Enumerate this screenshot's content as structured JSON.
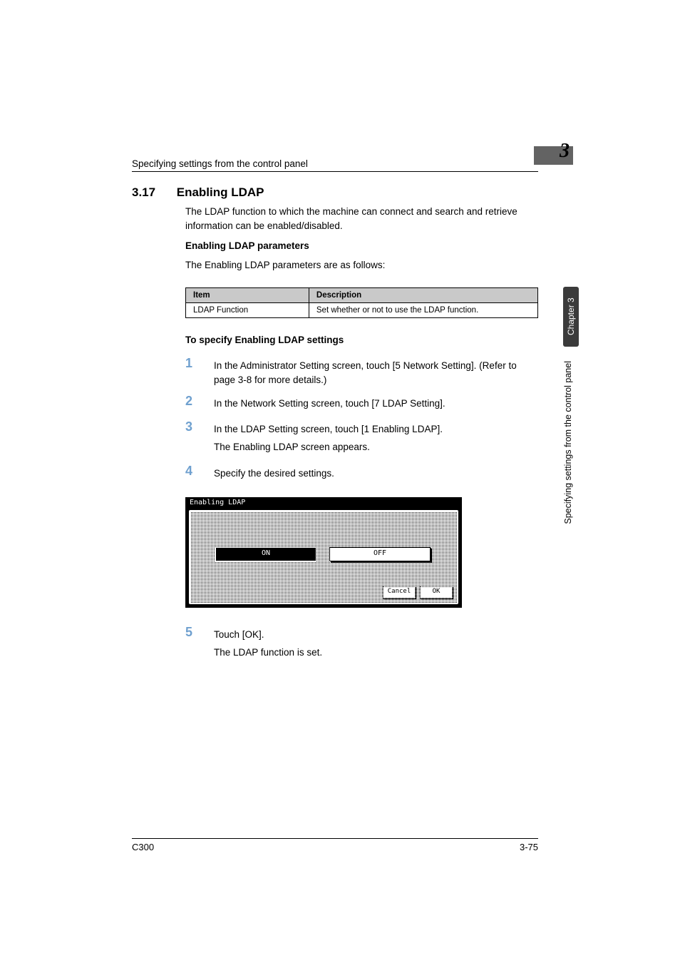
{
  "header": {
    "running_title": "Specifying settings from the control panel",
    "chapter_number": "3"
  },
  "section": {
    "number": "3.17",
    "title": "Enabling LDAP",
    "intro": "The LDAP function to which the machine can connect and search and retrieve information can be enabled/disabled."
  },
  "params": {
    "heading": "Enabling LDAP parameters",
    "lead": "The Enabling LDAP parameters are as follows:",
    "table": {
      "headers": {
        "item": "Item",
        "desc": "Description"
      },
      "rows": [
        {
          "item": "LDAP Function",
          "desc": "Set whether or not to use the LDAP function."
        }
      ]
    }
  },
  "procedure": {
    "heading": "To specify Enabling LDAP settings",
    "steps": [
      {
        "n": "1",
        "text": "In the Administrator Setting screen, touch [5 Network Setting]. (Refer to page 3-8 for more details.)"
      },
      {
        "n": "2",
        "text": "In the Network Setting screen, touch [7 LDAP Setting]."
      },
      {
        "n": "3",
        "text": "In the LDAP Setting screen, touch [1 Enabling LDAP].",
        "sub": "The Enabling LDAP screen appears."
      },
      {
        "n": "4",
        "text": "Specify the desired settings."
      },
      {
        "n": "5",
        "text": "Touch [OK].",
        "sub": "The LDAP function is set."
      }
    ]
  },
  "screenshot": {
    "title": "Enabling LDAP",
    "on": "ON",
    "off": "OFF",
    "cancel": "Cancel",
    "ok": "OK"
  },
  "side": {
    "chapter_tab": "Chapter 3",
    "running": "Specifying settings from the control panel"
  },
  "footer": {
    "model": "C300",
    "page": "3-75"
  }
}
